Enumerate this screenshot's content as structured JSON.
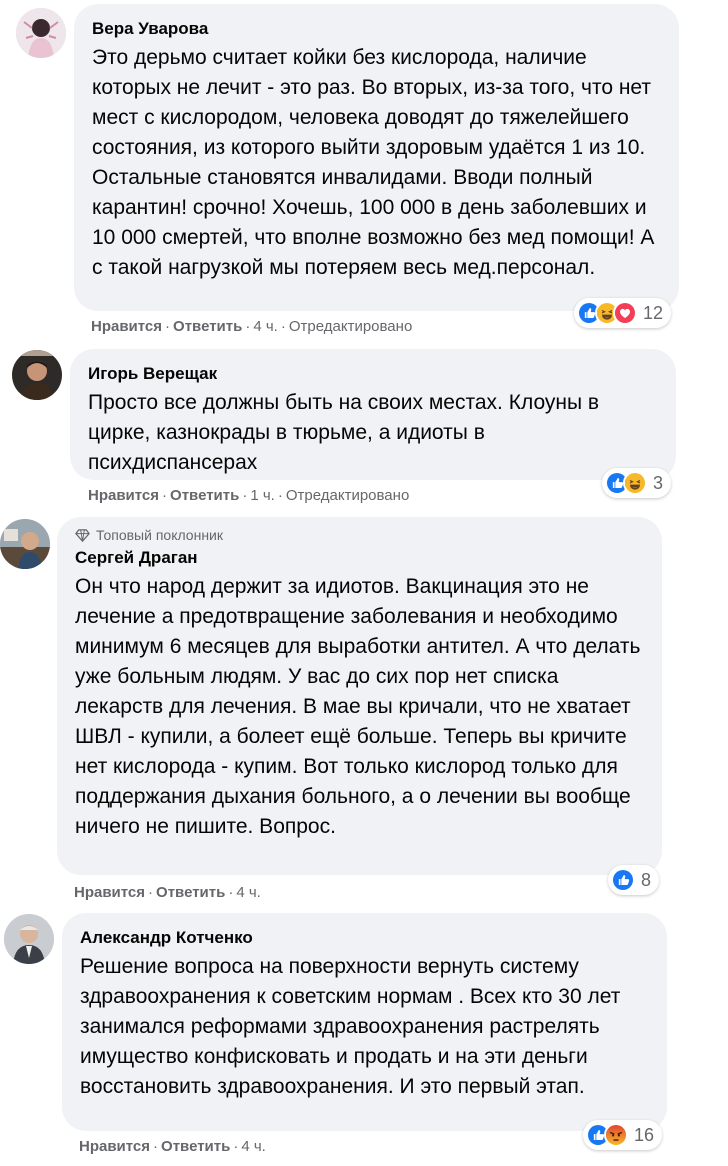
{
  "comments": [
    {
      "author": "Вера Уварова",
      "text": "Это дерьмо считает койки без кислорода, наличие которых не лечит - это раз. Во вторых, из-за того, что нет мест с кислородом, человека доводят до тяжелейшего состояния, из которого выйти здоровым удаётся 1 из 10. Остальные становятся инвалидами. Вводи полный карантин! срочно! Хочешь, 100 000 в день заболевших и 10 000 смертей, что вполне возможно без мед помощи! А с такой нагрузкой мы потеряем весь мед.персонал.",
      "like_label": "Нравится",
      "reply_label": "Ответить",
      "time": "4 ч.",
      "edited": "Отредактировано",
      "reaction_icons": [
        "like-icon",
        "haha-icon",
        "love-icon"
      ],
      "reaction_count": "12"
    },
    {
      "author": "Игорь Верещак",
      "text": "Просто все должны быть на своих местах. Клоуны в цирке, казнокрады в тюрьме, а идиоты в психдиспансерах",
      "like_label": "Нравится",
      "reply_label": "Ответить",
      "time": "1 ч.",
      "edited": "Отредактировано",
      "reaction_icons": [
        "like-icon",
        "haha-icon"
      ],
      "reaction_count": "3"
    },
    {
      "badge": "Топовый поклонник",
      "author": "Сергей Драган",
      "text": "Он что народ держит за идиотов. Вакцинация это не лечение а предотвращение заболевания и необходимо минимум 6 месяцев для выработки антител. А что делать уже больным людям. У вас до сих пор нет списка лекарств для лечения. В мае вы кричали, что не хватает ШВЛ - купили, а болеет ещё больше. Теперь вы кричите нет кислорода - купим. Вот только кислород только для поддержания дыхания больного, а о лечении вы вообще ничего не пишите. Вопрос.",
      "like_label": "Нравится",
      "reply_label": "Ответить",
      "time": "4 ч.",
      "reaction_icons": [
        "like-icon"
      ],
      "reaction_count": "8"
    },
    {
      "author": "Александр Котченко",
      "text": "Решение вопроса на поверхности вернуть систему здравоохранения к советским нормам . Всех кто 30 лет занимался реформами здравоохранения растрелять имущество конфисковать и продать и на эти деньги восстановить здравоохранения. И это первый этап.",
      "like_label": "Нравится",
      "reply_label": "Ответить",
      "time": "4 ч.",
      "reaction_icons": [
        "like-icon",
        "angry-icon"
      ],
      "reaction_count": "16"
    }
  ],
  "colors": {
    "bubble": "#f0f2f5",
    "meta_text": "#65676b",
    "like_blue": "#1877f2",
    "haha_yellow": "#f7b928",
    "love_red": "#f33e58",
    "angry_orange": "#e9710f"
  }
}
